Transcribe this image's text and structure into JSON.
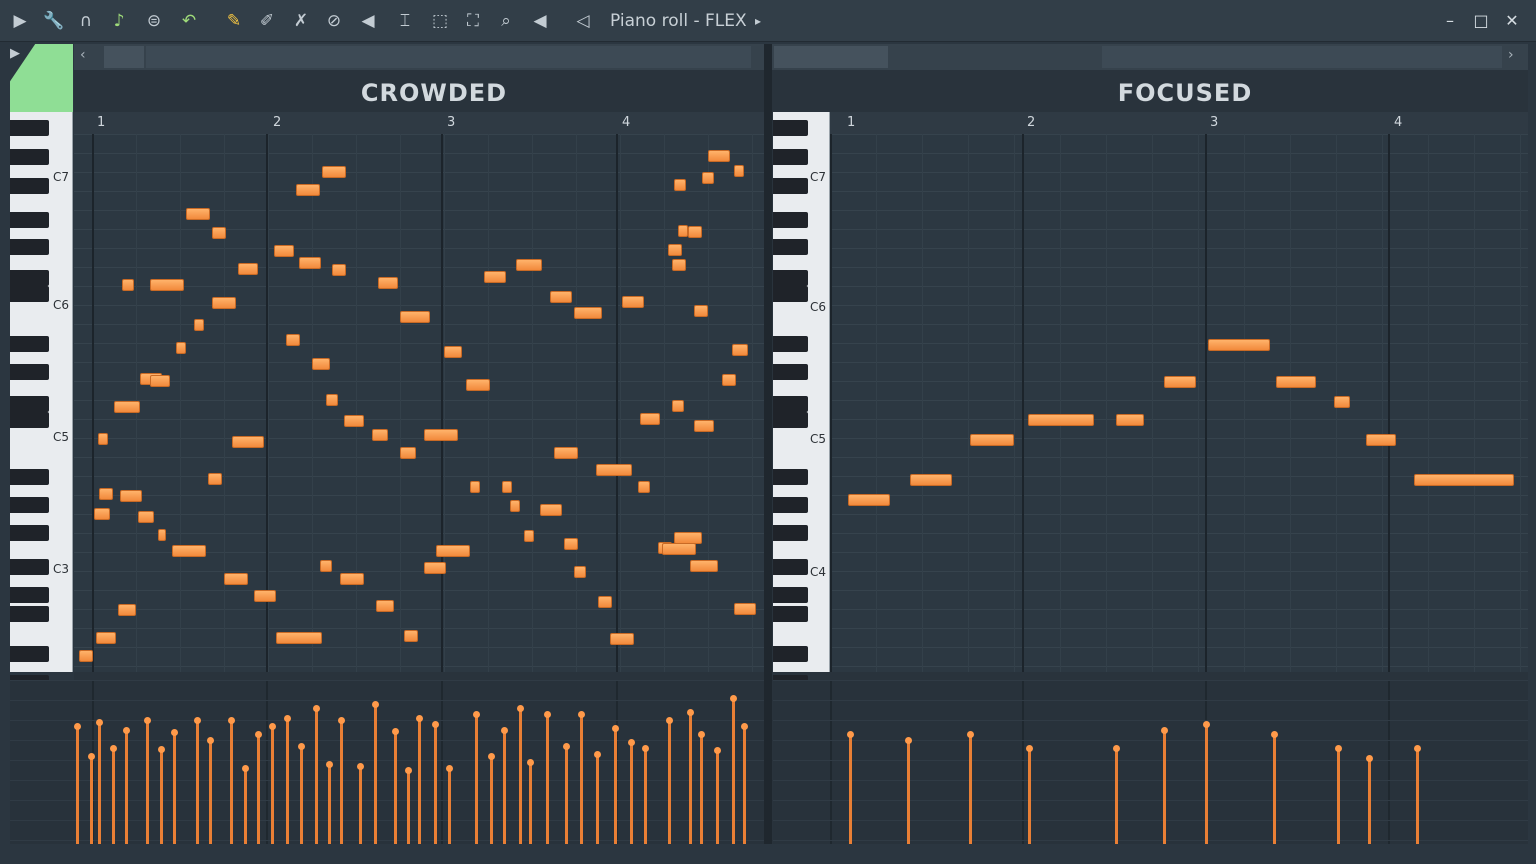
{
  "toolbar": {
    "title": "Piano roll - FLEX",
    "icons": [
      "play-arrow-icon",
      "wrench-icon",
      "magnet-icon",
      "note-icon",
      "menu-circle-icon",
      "undo-icon",
      "pencil-icon",
      "paint-brush-icon",
      "delete-icon",
      "mute-icon",
      "speaker-mute-icon",
      "slice-icon",
      "select-icon",
      "zoom-icon",
      "playback-icon",
      "volume-icon"
    ]
  },
  "window": {
    "minimize": "–",
    "maximize": "□",
    "close": "✕"
  },
  "panes": [
    {
      "title": "CROWDED",
      "bars": [
        "1",
        "2",
        "3",
        "4"
      ],
      "octaves": [
        "C7",
        "C6",
        "C5",
        "C3"
      ]
    },
    {
      "title": "FOCUSED",
      "bars": [
        "1",
        "2",
        "3",
        "4"
      ],
      "octaves": [
        "C7",
        "C6",
        "C5",
        "C4"
      ]
    }
  ],
  "colors": {
    "note": "#f28a3c",
    "grid": "#2c3842",
    "logo": "#8fde95"
  }
}
